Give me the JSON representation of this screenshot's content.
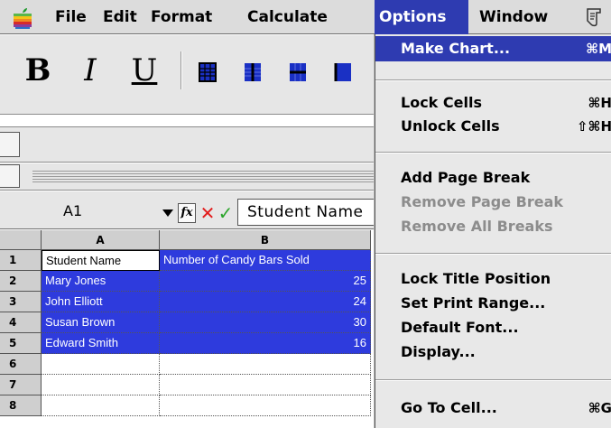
{
  "menubar": {
    "items": [
      "File",
      "Edit",
      "Format",
      "Calculate",
      "Options",
      "Window"
    ],
    "active": "Options",
    "apple_icon": "apple-logo-icon",
    "script_icon": "script-icon"
  },
  "toolbar": {
    "bold": "B",
    "italic": "I",
    "underline": "U"
  },
  "formula_bar": {
    "cell_ref": "A1",
    "fx": "fx",
    "cancel": "✕",
    "accept": "✓",
    "content": "Student Name"
  },
  "grid": {
    "columns": [
      "A",
      "B"
    ],
    "rows": [
      {
        "num": "1",
        "a": "Student Name",
        "b": "Number of Candy Bars Sold"
      },
      {
        "num": "2",
        "a": "Mary Jones",
        "b": "25"
      },
      {
        "num": "3",
        "a": "John Elliott",
        "b": "24"
      },
      {
        "num": "4",
        "a": "Susan Brown",
        "b": "30"
      },
      {
        "num": "5",
        "a": "Edward Smith",
        "b": "16"
      },
      {
        "num": "6",
        "a": "",
        "b": ""
      },
      {
        "num": "7",
        "a": "",
        "b": ""
      },
      {
        "num": "8",
        "a": "",
        "b": ""
      }
    ]
  },
  "options_menu": {
    "make_chart": {
      "label": "Make Chart...",
      "shortcut": "⌘M"
    },
    "lock_cells": {
      "label": "Lock Cells",
      "shortcut": "⌘H"
    },
    "unlock_cells": {
      "label": "Unlock Cells",
      "shortcut": "⇧⌘H"
    },
    "add_page_break": {
      "label": "Add Page Break"
    },
    "remove_page_break": {
      "label": "Remove Page Break"
    },
    "remove_all_breaks": {
      "label": "Remove All Breaks"
    },
    "lock_title_position": {
      "label": "Lock Title Position"
    },
    "set_print_range": {
      "label": "Set Print Range..."
    },
    "default_font": {
      "label": "Default Font..."
    },
    "display": {
      "label": "Display..."
    },
    "go_to_cell": {
      "label": "Go To Cell...",
      "shortcut": "⌘G"
    }
  },
  "colors": {
    "selection": "#2e3bdd",
    "menu_highlight": "#2e3bb1",
    "cancel_red": "#e21b1b",
    "accept_green": "#2aa52a"
  }
}
